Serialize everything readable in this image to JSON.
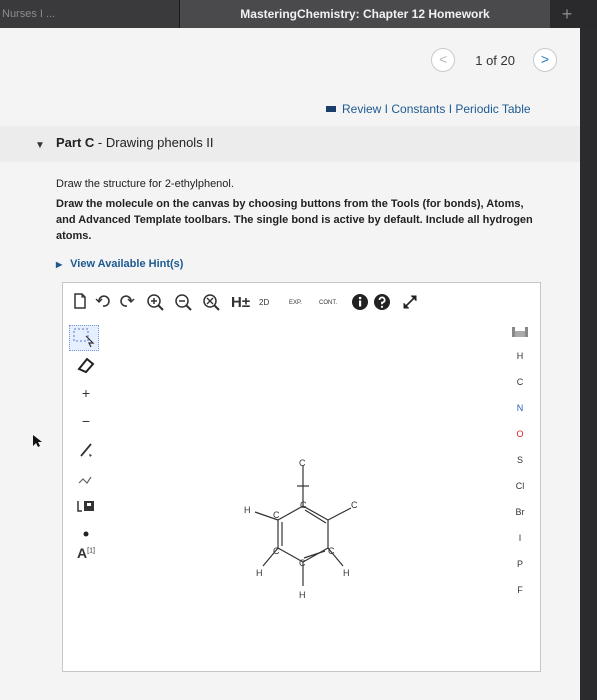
{
  "tabs": {
    "left": "Nurses I ...",
    "active": "MasteringChemistry: Chapter 12 Homework",
    "new_tab": "+"
  },
  "pager": {
    "prev": "<",
    "position": "1 of 20",
    "next": ">"
  },
  "resources": "Review I Constants I Periodic Table",
  "part": {
    "label": "Part C",
    "separator": " - ",
    "title": "Drawing phenols II"
  },
  "prompt": {
    "line1": "Draw the structure for 2-ethylphenol.",
    "line2": "Draw the molecule on the canvas by choosing buttons from the Tools (for bonds), Atoms, and Advanced Template toolbars. The single bond is active by default. Include all hydrogen atoms."
  },
  "hint": "View Available Hint(s)",
  "toolbar": {
    "hplus": "H±",
    "twoD": "2D",
    "exp": "EXP.",
    "cont": "CONT."
  },
  "left_tools": {
    "plus": "+",
    "minus": "−",
    "stereo": "A",
    "stereo_sup": "[1]"
  },
  "atoms": [
    "H",
    "C",
    "N",
    "O",
    "S",
    "Cl",
    "Br",
    "I",
    "P",
    "F"
  ],
  "molecule": {
    "h_left": "H",
    "c_top": "C",
    "c_ring_tr": "C",
    "c_ext": "C",
    "c_left_upper": "C",
    "c_left_lower": "C",
    "c_right_lower": "C",
    "c_bottom": "C",
    "h_bl": "H",
    "h_br": "H",
    "h_bottom": "H"
  }
}
